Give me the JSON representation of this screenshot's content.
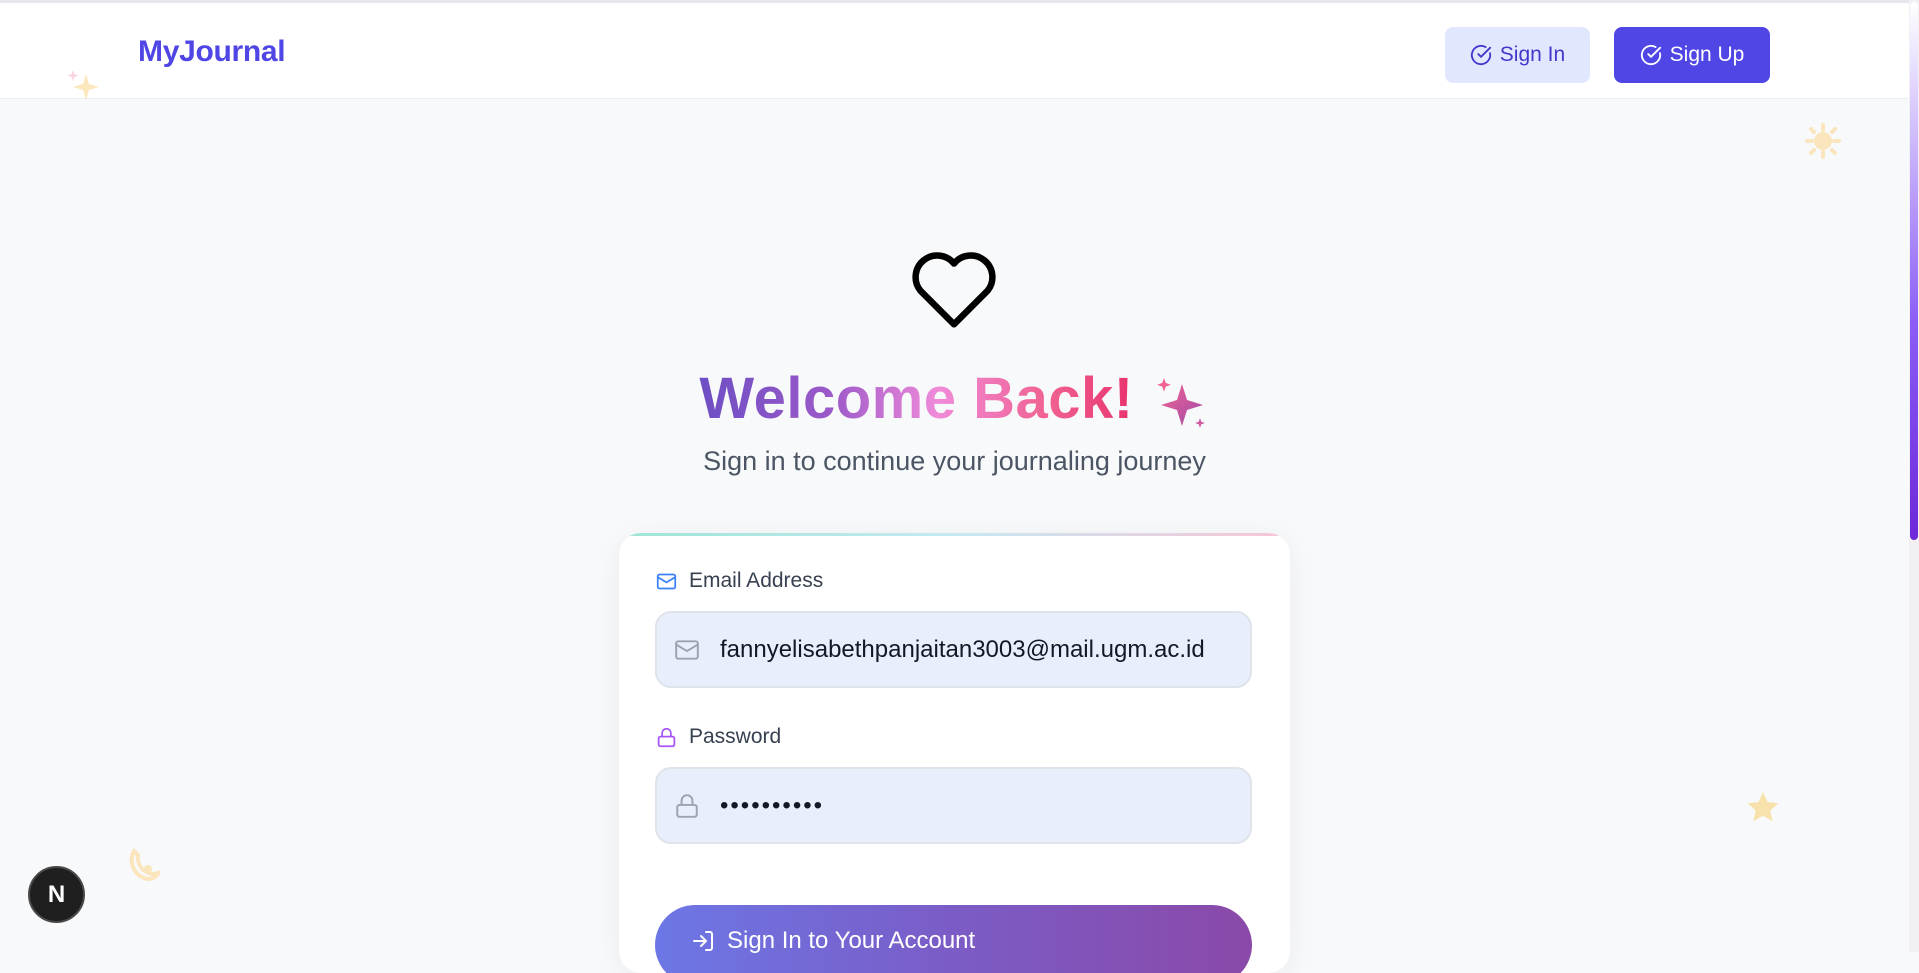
{
  "header": {
    "brand": "MyJournal",
    "signin_label": "Sign In",
    "signup_label": "Sign Up"
  },
  "hero": {
    "title": "Welcome Back!",
    "subtitle": "Sign in to continue your journaling journey"
  },
  "form": {
    "email_label": "Email Address",
    "email_value": "fannyelisabethpanjaitan3003@mail.ugm.ac.id",
    "password_label": "Password",
    "password_masked": "••••••••••",
    "submit_label": "Sign In to Your Account"
  },
  "dev_badge": {
    "letter": "N"
  },
  "colors": {
    "brand": "#4f46e5",
    "signin_bg": "#e0e7ff",
    "page_bg": "#f8f9fb",
    "input_bg": "#e8eefb"
  },
  "icons": [
    "check-circle-icon",
    "heart-icon",
    "sparkles-icon",
    "mail-icon",
    "lock-icon",
    "log-in-icon",
    "star-icon",
    "sun-icon",
    "moon-icon"
  ]
}
